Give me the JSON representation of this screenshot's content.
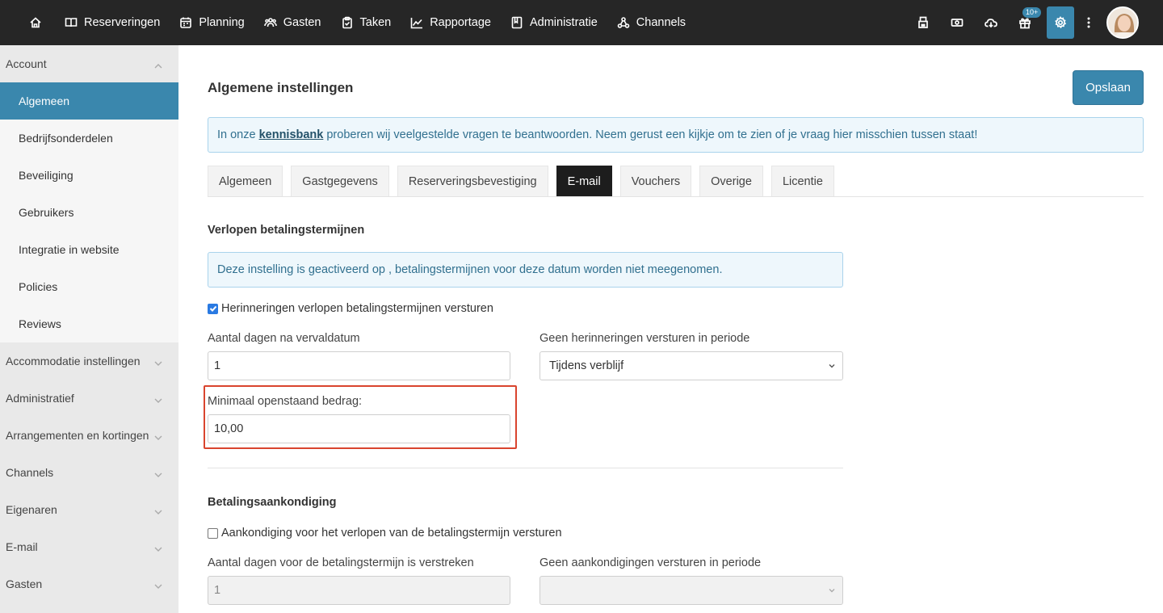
{
  "nav": {
    "items": [
      {
        "label": "Reserveringen",
        "icon": "book-icon"
      },
      {
        "label": "Planning",
        "icon": "calendar-icon"
      },
      {
        "label": "Gasten",
        "icon": "users-icon"
      },
      {
        "label": "Taken",
        "icon": "clipboard-icon"
      },
      {
        "label": "Rapportage",
        "icon": "chart-icon"
      },
      {
        "label": "Administratie",
        "icon": "ledger-icon"
      },
      {
        "label": "Channels",
        "icon": "channels-icon"
      }
    ],
    "badge": "10+"
  },
  "sidebar": {
    "account": "Account",
    "items": [
      "Algemeen",
      "Bedrijfsonderdelen",
      "Beveiliging",
      "Gebruikers",
      "Integratie in website",
      "Policies",
      "Reviews"
    ],
    "groups": [
      "Accommodatie instellingen",
      "Administratief",
      "Arrangementen en kortingen",
      "Channels",
      "Eigenaren",
      "E-mail",
      "Gasten"
    ]
  },
  "main": {
    "title": "Algemene instellingen",
    "save_label": "Opslaan",
    "info_prefix": "In onze",
    "info_link": "kennisbank",
    "info_suffix": "proberen wij veelgestelde vragen te beantwoorden. Neem gerust een kijkje om te zien of je vraag hier misschien tussen staat!",
    "tabs": [
      "Algemeen",
      "Gastgegevens",
      "Reserveringsbevestiging",
      "E-mail",
      "Vouchers",
      "Overige",
      "Licentie"
    ],
    "active_tab": "E-mail"
  },
  "section1": {
    "title": "Verlopen betalingstermijnen",
    "note": "Deze instelling is geactiveerd op , betalingstermijnen voor deze datum worden niet meegenomen.",
    "checkbox_label": "Herinneringen verlopen betalingstermijnen versturen",
    "checkbox_checked": true,
    "days_label": "Aantal dagen na vervaldatum",
    "days_value": "1",
    "period_label": "Geen herinneringen versturen in periode",
    "period_value": "Tijdens verblijf",
    "min_label": "Minimaal openstaand bedrag:",
    "min_value": "10,00"
  },
  "section2": {
    "title": "Betalingsaankondiging",
    "checkbox_label": "Aankondiging voor het verlopen van de betalingstermijn versturen",
    "checkbox_checked": false,
    "days_label": "Aantal dagen voor de betalingstermijn is verstreken",
    "days_value": "1",
    "period_label": "Geen aankondigingen versturen in periode",
    "period_value": ""
  },
  "colors": {
    "accent": "#3a87ad",
    "highlight": "#d9442e",
    "navbar": "#262626"
  }
}
